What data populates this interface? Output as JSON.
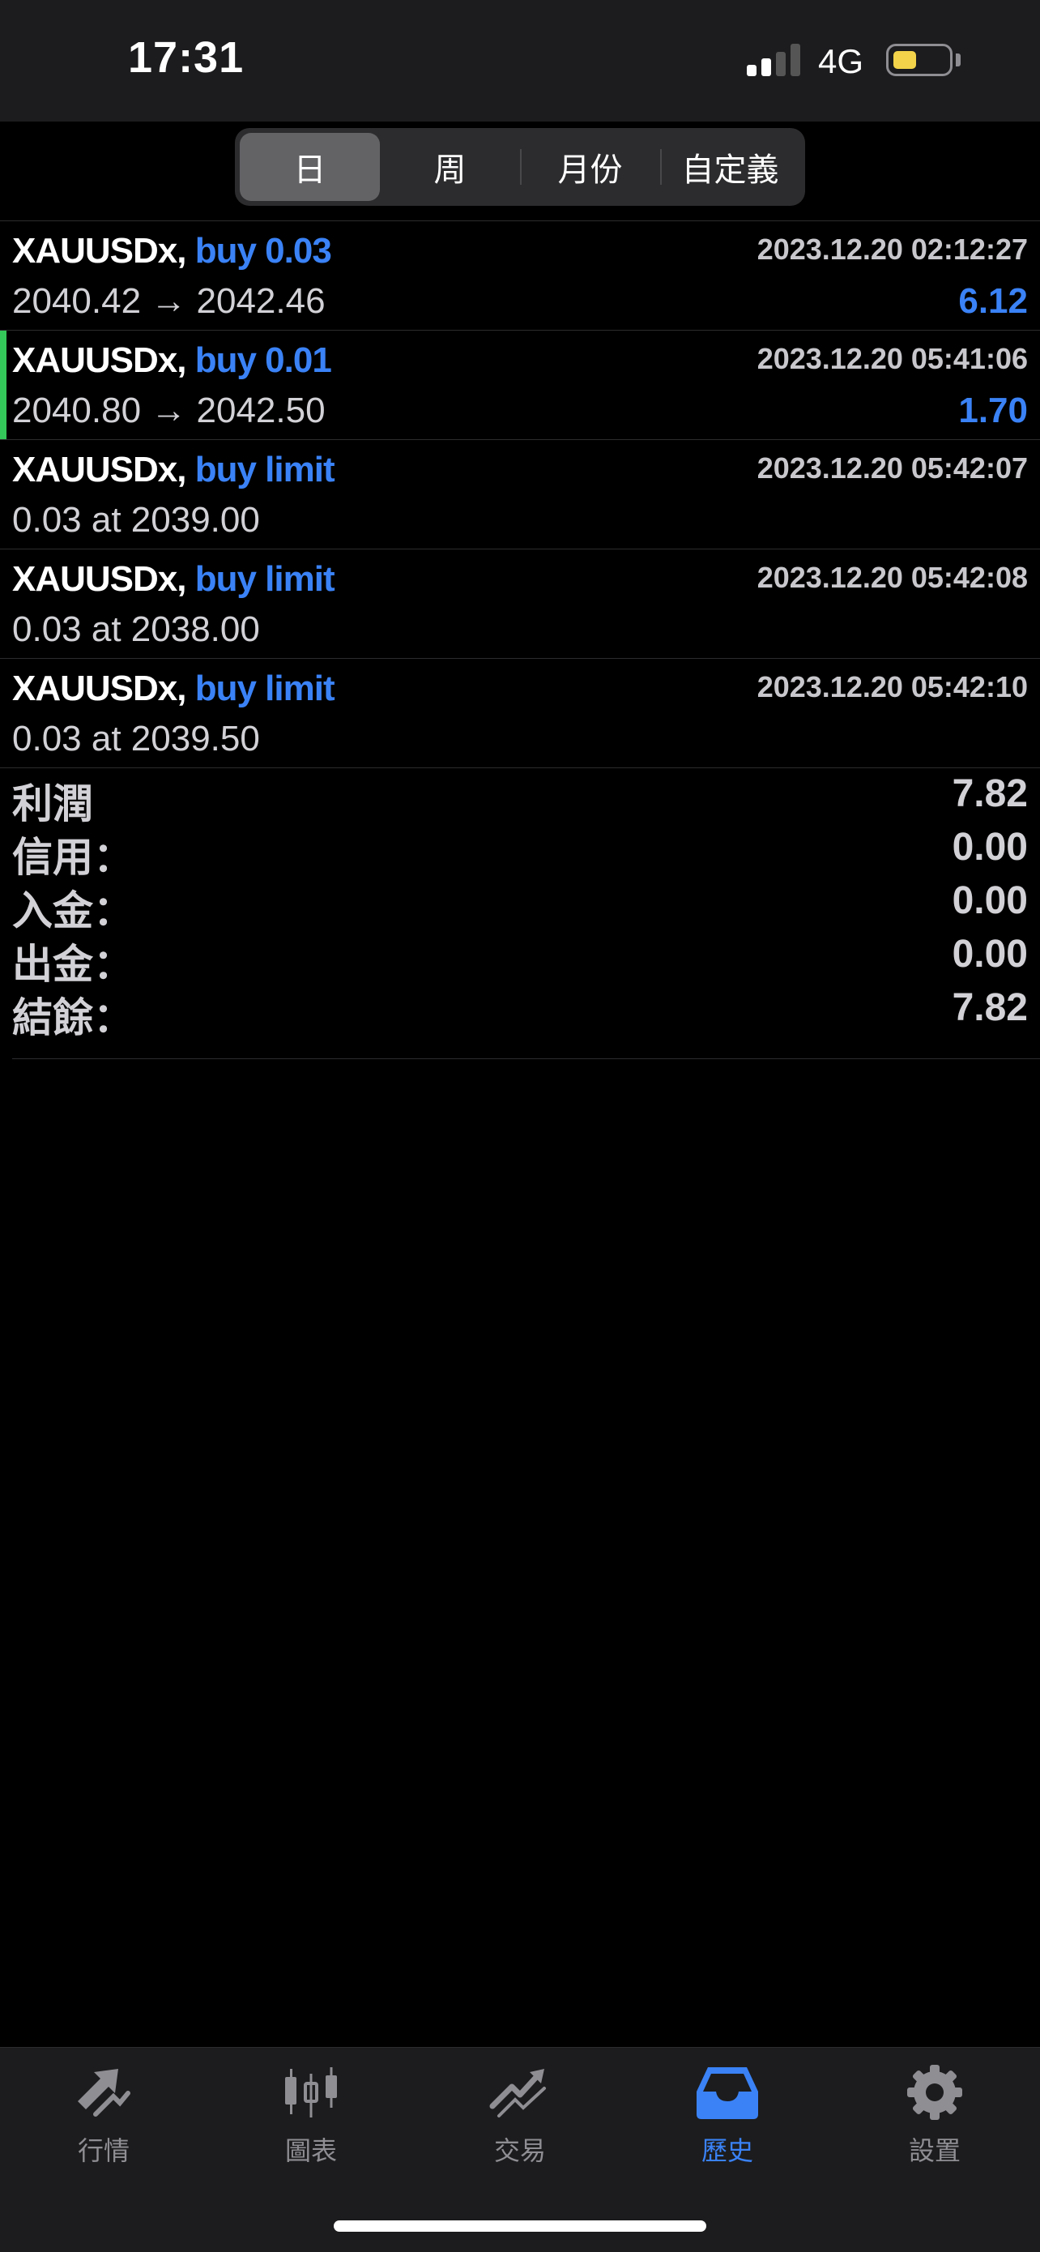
{
  "status_bar": {
    "time": "17:31",
    "network": "4G"
  },
  "segments": [
    {
      "label": "日",
      "active": true
    },
    {
      "label": "周",
      "active": false
    },
    {
      "label": "月份",
      "active": false
    },
    {
      "label": "自定義",
      "active": false
    }
  ],
  "deals": [
    {
      "symbol": "XAUUSDx,",
      "action": "buy 0.03",
      "time": "2023.12.20 02:12:27",
      "detail": "2040.42 → 2042.46",
      "profit": "6.12"
    },
    {
      "symbol": "XAUUSDx,",
      "action": "buy 0.01",
      "time": "2023.12.20 05:41:06",
      "detail": "2040.80 → 2042.50",
      "profit": "1.70"
    },
    {
      "symbol": "XAUUSDx,",
      "action": "buy limit",
      "time": "2023.12.20 05:42:07",
      "detail": "0.03 at 2039.00",
      "profit": ""
    },
    {
      "symbol": "XAUUSDx,",
      "action": "buy limit",
      "time": "2023.12.20 05:42:08",
      "detail": "0.03 at 2038.00",
      "profit": ""
    },
    {
      "symbol": "XAUUSDx,",
      "action": "buy limit",
      "time": "2023.12.20 05:42:10",
      "detail": "0.03 at 2039.50",
      "profit": ""
    }
  ],
  "summary": {
    "profit_label": "利潤",
    "profit_value": "7.82",
    "credit_label": "信用：",
    "credit_value": "0.00",
    "deposit_label": "入金：",
    "deposit_value": "0.00",
    "withdrawal_label": "出金：",
    "withdrawal_value": "0.00",
    "balance_label": "結餘：",
    "balance_value": "7.82"
  },
  "tabbar": [
    {
      "label": "行情",
      "icon": "quotes-icon",
      "active": false
    },
    {
      "label": "圖表",
      "icon": "chart-icon",
      "active": false
    },
    {
      "label": "交易",
      "icon": "trade-icon",
      "active": false
    },
    {
      "label": "歷史",
      "icon": "history-icon",
      "active": true
    },
    {
      "label": "設置",
      "icon": "gear-icon",
      "active": false
    }
  ],
  "colors": {
    "accent": "#3a82f6",
    "highlight": "#34c759",
    "battery": "#f2d34a"
  }
}
